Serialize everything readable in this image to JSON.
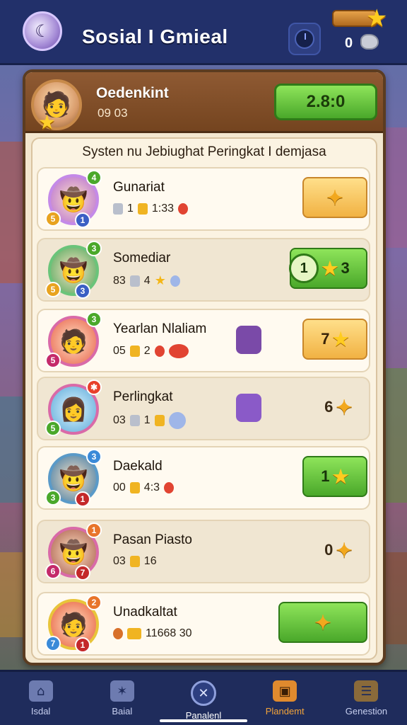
{
  "header": {
    "title": "Sosial I Gmieal",
    "logo_icon": "moon-logo-icon",
    "currency_value": "0"
  },
  "profile": {
    "name": "Oedenkint",
    "sub": "09 03",
    "score": "2.8:0"
  },
  "list": {
    "title": "Systen nu Jebiughat Peringkat I demjasa",
    "rows": [
      {
        "name": "Gunariat",
        "stats": [
          "1",
          "1:33"
        ],
        "badges": [
          "4",
          "5",
          "1"
        ],
        "action": "",
        "action_style": "orange-wand"
      },
      {
        "name": "Somediar",
        "stats": [
          "83",
          "4",
          ""
        ],
        "badges": [
          "3",
          "5",
          "3"
        ],
        "action": "3",
        "action_left": "1",
        "action_style": "combo"
      },
      {
        "name": "Yearlan Nlaliam",
        "stats": [
          "05",
          "2"
        ],
        "badges": [
          "3",
          "5",
          ""
        ],
        "action": "7",
        "action_style": "orange-star"
      },
      {
        "name": "Perlingkat",
        "stats": [
          "03",
          "1"
        ],
        "badges": [
          "",
          "5",
          ""
        ],
        "action": "6",
        "action_style": "plain-wand"
      },
      {
        "name": "Daekald",
        "stats": [
          "00",
          "4:3"
        ],
        "badges": [
          "3",
          "3",
          "1"
        ],
        "action": "1",
        "action_style": "green-star"
      },
      {
        "name": "Pasan Piasto",
        "stats": [
          "03",
          "16"
        ],
        "badges": [
          "1",
          "6",
          "7"
        ],
        "action": "0",
        "action_style": "plain-wand"
      },
      {
        "name": "Unadkaltat",
        "stats": [
          "11668 30"
        ],
        "badges": [
          "2",
          "7",
          "1"
        ],
        "action": "",
        "action_style": "green-wand"
      }
    ]
  },
  "nav": {
    "items": [
      {
        "label": "Isdal"
      },
      {
        "label": "Baial"
      },
      {
        "label": "Panalenl"
      },
      {
        "label": "Plandemt"
      },
      {
        "label": "Genestion"
      }
    ]
  },
  "colors": {
    "topbar": "#22306a",
    "panel": "#f3e7cf",
    "green": "#4aa82a",
    "orange": "#f1b243"
  }
}
